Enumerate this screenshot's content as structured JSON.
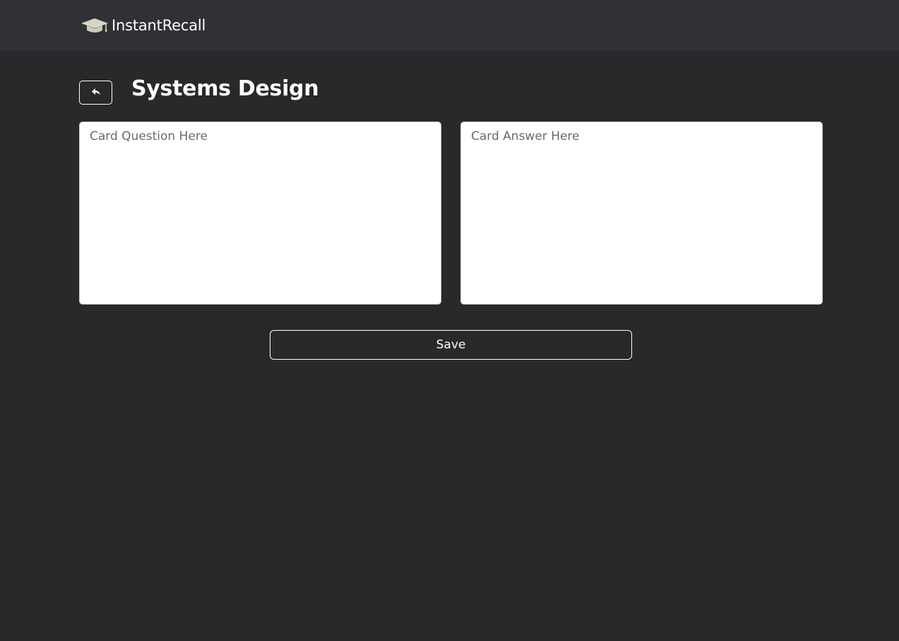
{
  "navbar": {
    "brand_name": "InstantRecall",
    "logo_icon": "graduation-cap-icon"
  },
  "header": {
    "back_icon": "reply-arrow-icon",
    "title": "Systems Design"
  },
  "form": {
    "question_placeholder": "Card Question Here",
    "question_value": "",
    "answer_placeholder": "Card Answer Here",
    "answer_value": "",
    "save_label": "Save"
  },
  "colors": {
    "background": "#28292b",
    "navbar": "#2f3135",
    "logo": "#d9d6c6",
    "text": "#ffffff"
  }
}
